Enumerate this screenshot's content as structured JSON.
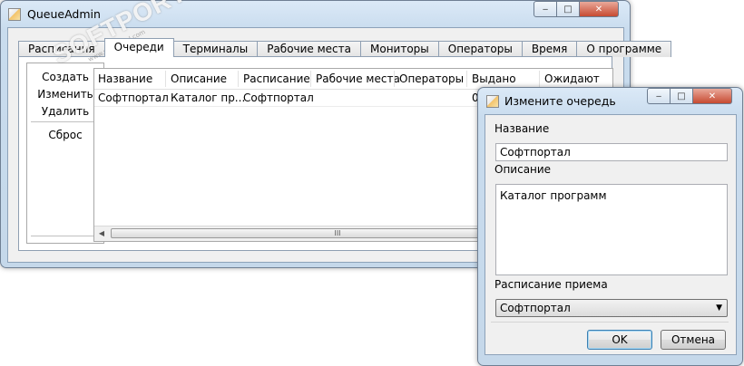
{
  "main_window": {
    "title": "QueueAdmin",
    "tabs": [
      "Расписания",
      "Очереди",
      "Терминалы",
      "Рабочие места",
      "Мониторы",
      "Операторы",
      "Время",
      "О программе"
    ],
    "active_tab": "Очереди",
    "actions": [
      "Создать",
      "Изменить",
      "Удалить",
      "Сброс"
    ],
    "grid": {
      "columns": [
        "Название",
        "Описание",
        "Расписание",
        "Рабочие места",
        "Операторы",
        "Выдано",
        "Ожидают"
      ],
      "rows": [
        [
          "Софтпортал",
          "Каталог пр...",
          "Софтпортал",
          "",
          "",
          "0",
          ""
        ]
      ]
    },
    "scroll_grip": "III",
    "caption_buttons": {
      "minimize": "‒",
      "maximize": "□",
      "close": "✕"
    }
  },
  "watermark": {
    "text": "SOFTPORTAL",
    "sub": "www.softportal.com"
  },
  "dialog": {
    "title": "Измените очередь",
    "name_label": "Название",
    "name_value": "Софтпортал",
    "description_label": "Описание",
    "description_value": "Каталог программ",
    "schedule_label": "Расписание приема",
    "schedule_value": "Софтпортал",
    "ok_label": "OK",
    "cancel_label": "Отмена",
    "caption_buttons": {
      "minimize": "‒",
      "maximize": "□",
      "close": "✕"
    }
  }
}
